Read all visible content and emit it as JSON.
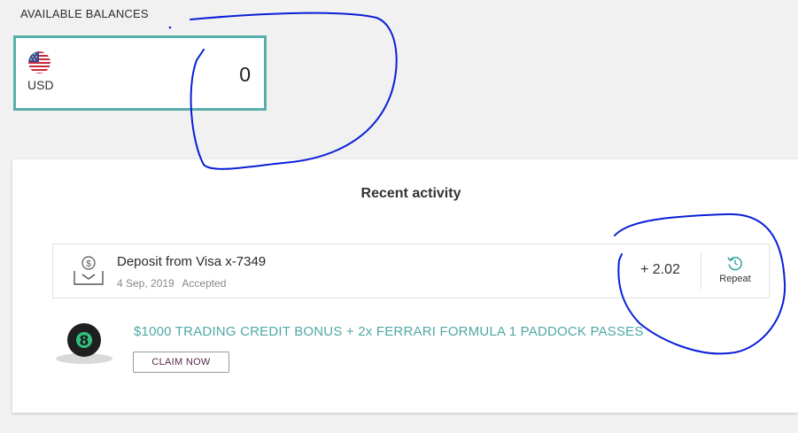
{
  "balances": {
    "title": "AVAILABLE BALANCES",
    "currency": "USD",
    "amount": "0",
    "flag_icon": "us-flag-icon",
    "accent_color": "#59aeaa"
  },
  "activity": {
    "title": "Recent activity",
    "items": [
      {
        "icon": "deposit-icon",
        "title": "Deposit from Visa x-7349",
        "date": "4 Sep, 2019",
        "status": "Accepted",
        "amount": "+ 2.02",
        "action_label": "Repeat",
        "action_icon": "repeat-icon"
      }
    ]
  },
  "promo": {
    "badge_icon": "eight-ball-icon",
    "text": "$1000 TRADING CREDIT BONUS + 2x FERRARI FORMULA 1 PADDOCK PASSES",
    "button_label": "CLAIM NOW",
    "text_color": "#4fa8a5"
  },
  "annotation": {
    "color": "#0a1fd6"
  }
}
